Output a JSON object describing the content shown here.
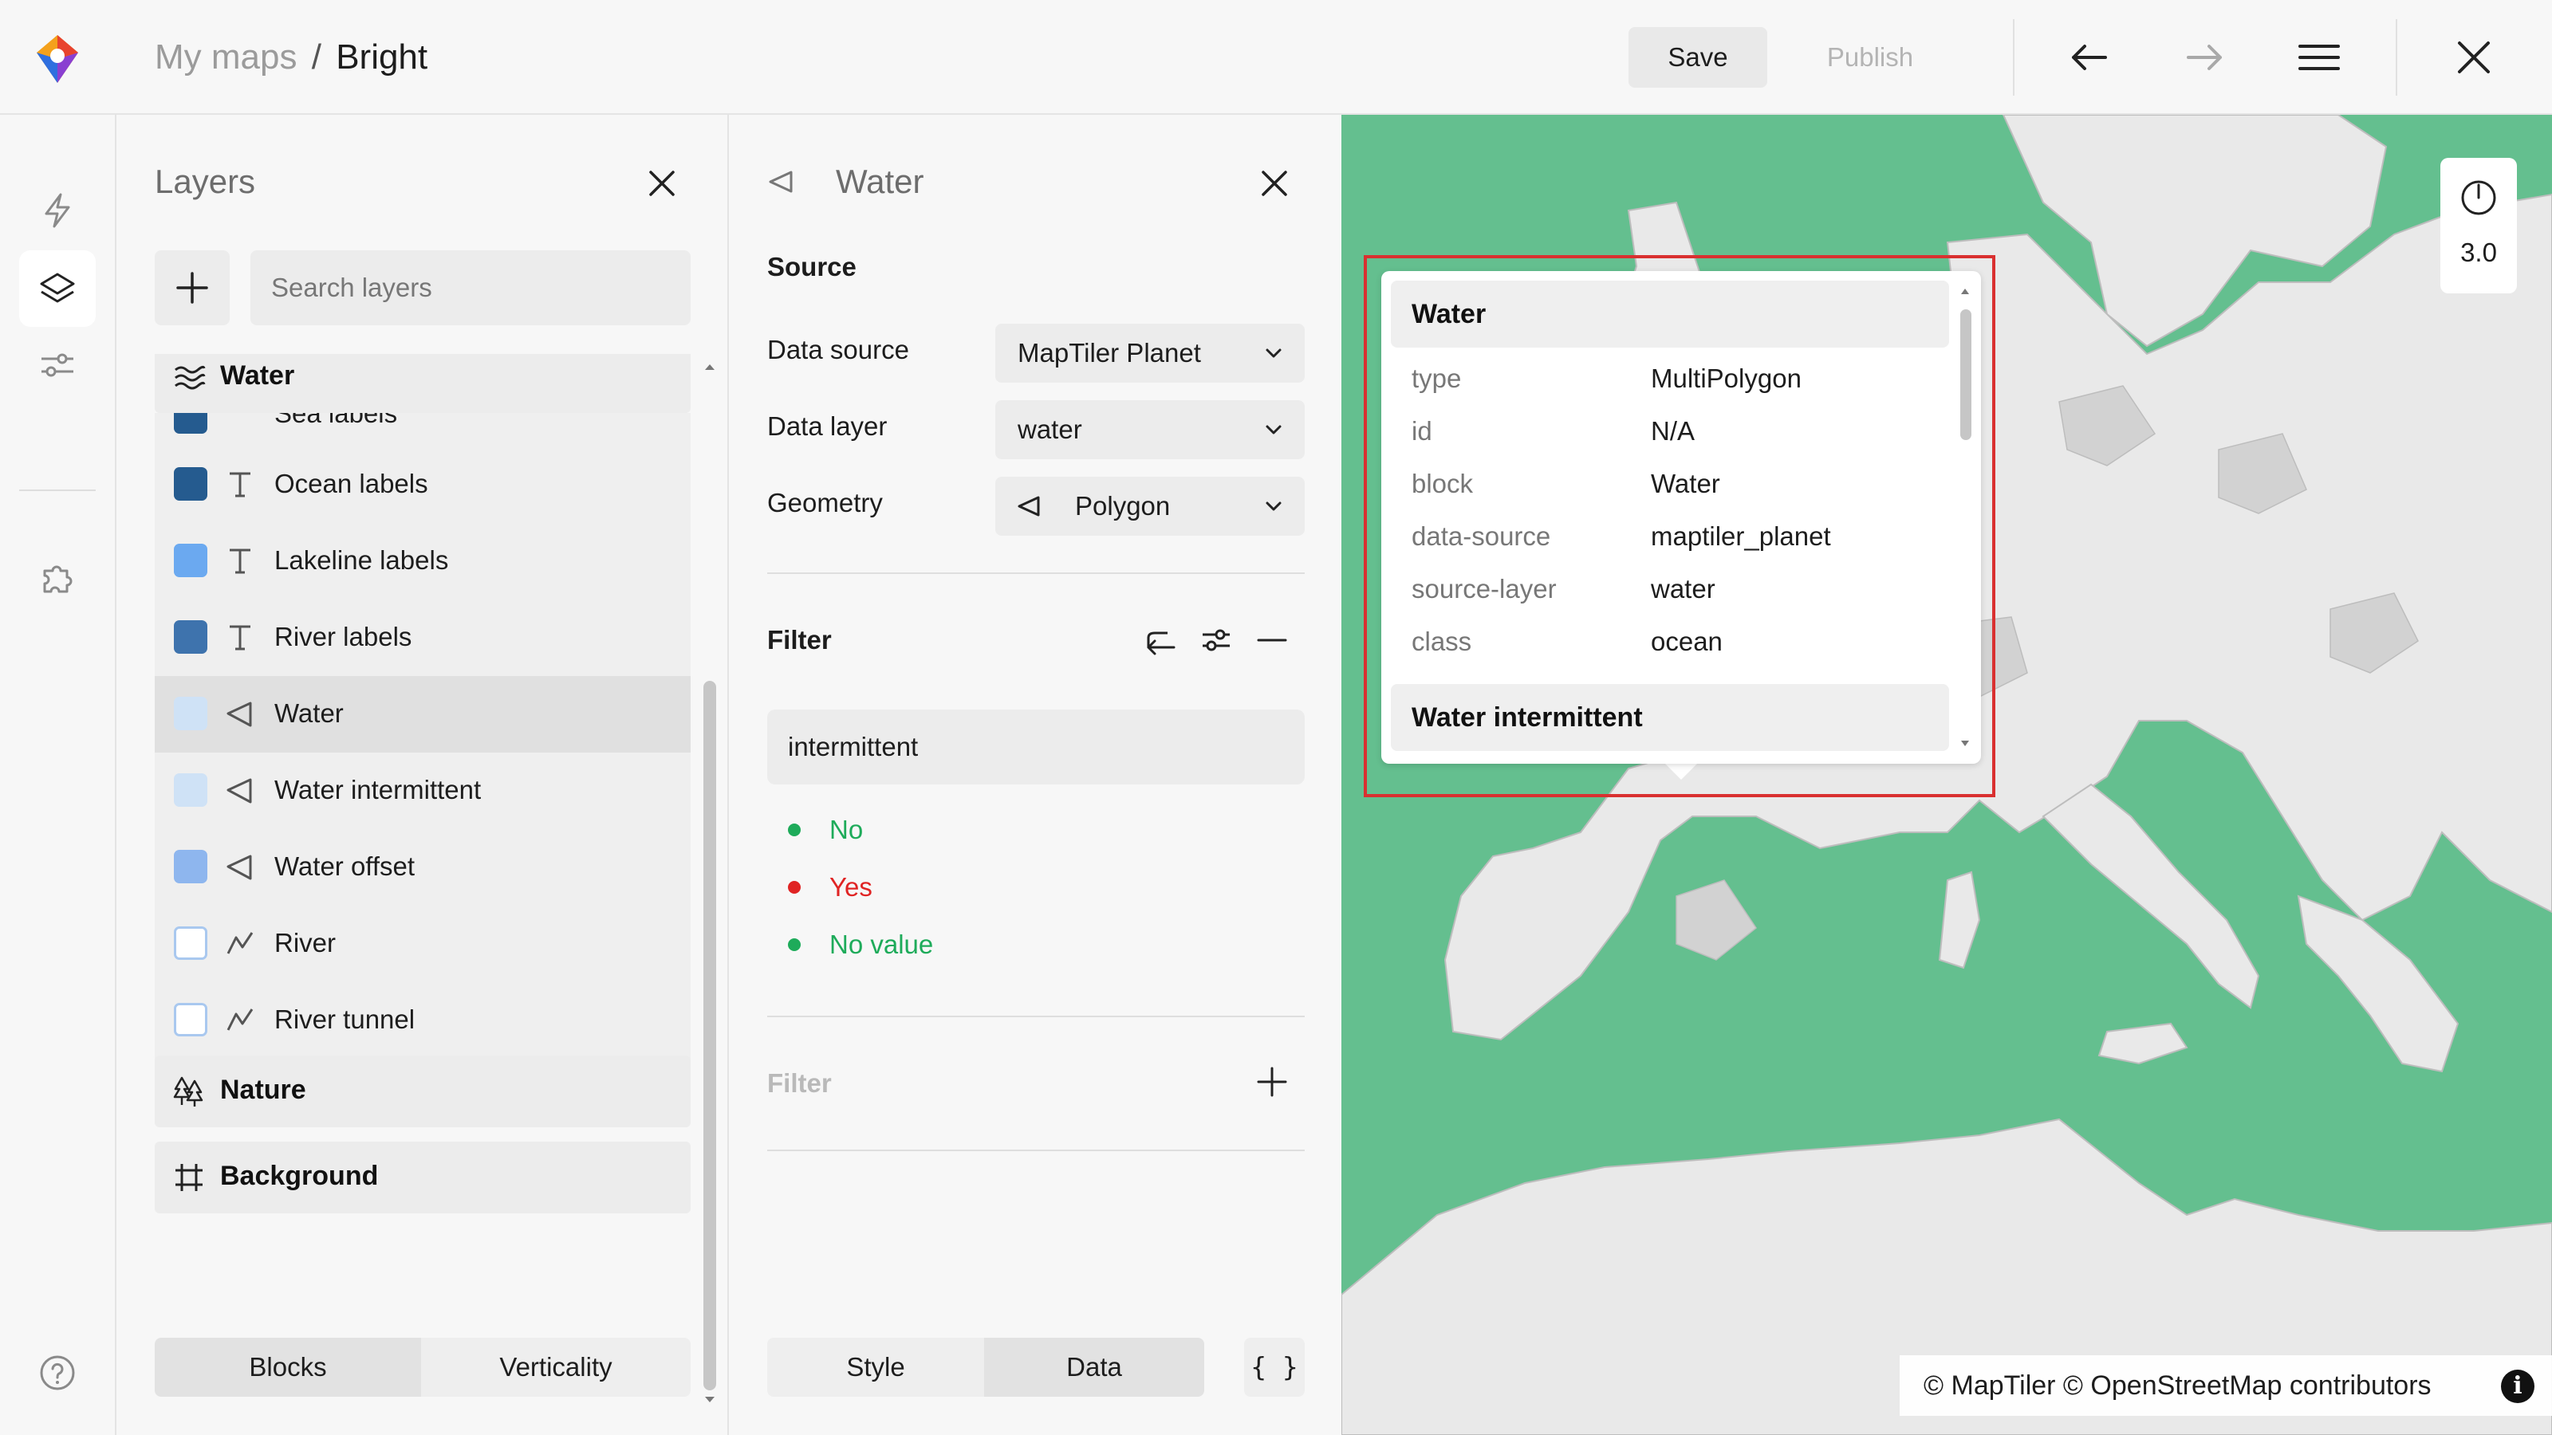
{
  "breadcrumb": {
    "parent": "My maps",
    "separator": "/",
    "current": "Bright"
  },
  "toolbar": {
    "save_label": "Save",
    "publish_label": "Publish"
  },
  "layers_panel": {
    "title": "Layers",
    "search_placeholder": "Search layers",
    "groups": [
      {
        "label": "Water",
        "icon": "water-waves-icon"
      },
      {
        "label": "Nature",
        "icon": "trees-icon"
      },
      {
        "label": "Background",
        "icon": "grid-hash-icon"
      }
    ],
    "partial_top_label": "Sea labels",
    "items": [
      {
        "label": "Ocean labels",
        "type": "text",
        "color": "#255b8f",
        "selected": false
      },
      {
        "label": "Lakeline labels",
        "type": "text",
        "color": "#6ba9f0",
        "selected": false
      },
      {
        "label": "River labels",
        "type": "text",
        "color": "#3e73ad",
        "selected": false
      },
      {
        "label": "Water",
        "type": "polygon",
        "color": "#cfe2f6",
        "selected": true
      },
      {
        "label": "Water intermittent",
        "type": "polygon",
        "color": "#cfe2f6",
        "selected": false
      },
      {
        "label": "Water offset",
        "type": "polygon",
        "color": "#8eb6ee",
        "selected": false
      },
      {
        "label": "River",
        "type": "line",
        "color": "#ffffff",
        "selected": false
      },
      {
        "label": "River tunnel",
        "type": "line",
        "color": "#ffffff",
        "selected": false
      }
    ],
    "mode_tabs": [
      "Blocks",
      "Verticality"
    ],
    "active_mode": "Blocks"
  },
  "editor": {
    "title": "Water",
    "source_heading": "Source",
    "fields": [
      {
        "label": "Data source",
        "value": "MapTiler Planet"
      },
      {
        "label": "Data layer",
        "value": "water"
      },
      {
        "label": "Geometry",
        "value": "Polygon"
      }
    ],
    "filter_heading": "Filter",
    "filter_value": "intermittent",
    "filter_options": [
      {
        "label": "No",
        "color": "#1eab5a"
      },
      {
        "label": "Yes",
        "color": "#e02424"
      },
      {
        "label": "No value",
        "color": "#1eab5a"
      }
    ],
    "add_filter_label": "Filter",
    "tabs": [
      "Style",
      "Data"
    ],
    "active_tab": "Data",
    "json_button": "{ }"
  },
  "map": {
    "zoom": "3.0",
    "attribution": "© MapTiler © OpenStreetMap contributors",
    "water_color": "#64bf8f",
    "land_color": "#e9e9e9",
    "popup": {
      "heading": "Water",
      "properties": [
        {
          "key": "type",
          "value": "MultiPolygon"
        },
        {
          "key": "id",
          "value": "N/A"
        },
        {
          "key": "block",
          "value": "Water"
        },
        {
          "key": "data-source",
          "value": "maptiler_planet"
        },
        {
          "key": "source-layer",
          "value": "water"
        },
        {
          "key": "class",
          "value": "ocean"
        }
      ],
      "next_heading": "Water intermittent"
    }
  },
  "accent_colors": {
    "highlight_border": "#d93030"
  }
}
